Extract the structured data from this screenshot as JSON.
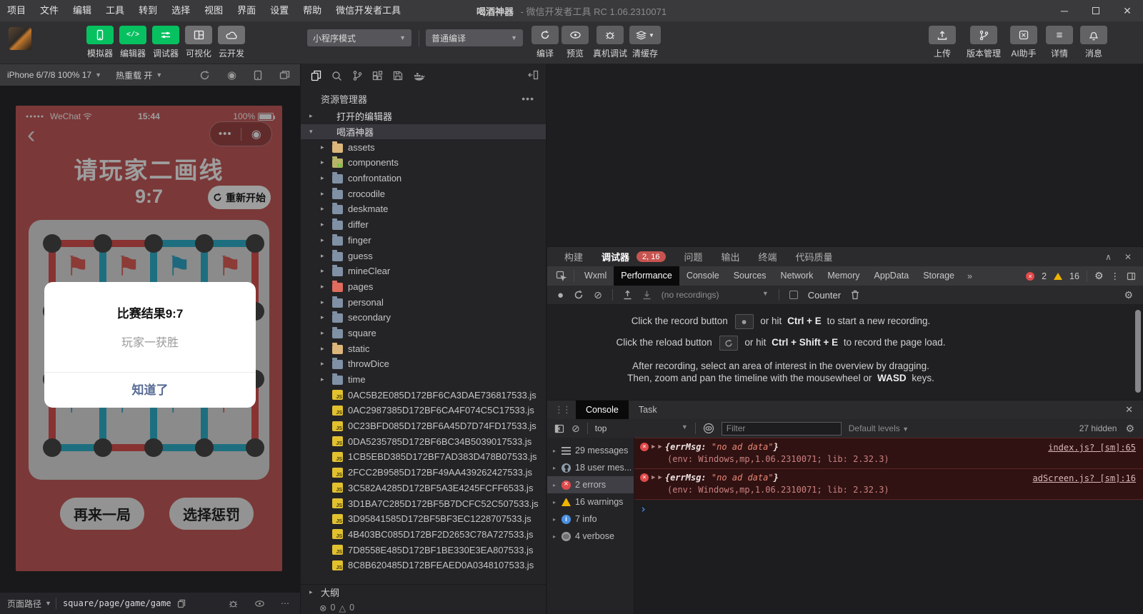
{
  "colors": {
    "green": "#07c160",
    "phone-red": "#c75b5b",
    "board": "#e0e0e0",
    "dot": "#474747",
    "line-red": "#de5252",
    "line-teal": "#2fb3ce",
    "flag-red": "#e25f5a",
    "flag-teal": "#2fa8c8",
    "link-blue": "#576b95"
  },
  "titlebar": {
    "menus": [
      "项目",
      "文件",
      "编辑",
      "工具",
      "转到",
      "选择",
      "视图",
      "界面",
      "设置",
      "帮助",
      "微信开发者工具"
    ],
    "app": "喝酒神器",
    "product": "- 微信开发者工具 RC 1.06.2310071"
  },
  "toolbar": {
    "buttons": [
      {
        "label": "模拟器"
      },
      {
        "label": "编辑器"
      },
      {
        "label": "调试器"
      },
      {
        "label": "可视化"
      },
      {
        "label": "云开发"
      }
    ],
    "mode": "小程序模式",
    "compile_mode": "普通编译",
    "actions": {
      "compile": "编译",
      "preview": "预览",
      "remote": "真机调试",
      "cache": "清缓存"
    },
    "right": [
      {
        "label": "上传"
      },
      {
        "label": "版本管理"
      },
      {
        "label": "AI助手"
      },
      {
        "label": "详情"
      },
      {
        "label": "消息"
      }
    ]
  },
  "simulator": {
    "device": "iPhone 6/7/8 100% 17",
    "hot_reload": "热重载 开",
    "status": {
      "carrier": "WeChat",
      "time": "15:44",
      "battery": "100%"
    },
    "screen": {
      "title": "请玩家二画线",
      "score": "9:7",
      "restart": "重新开始",
      "flags_top": [
        "red",
        "red",
        "teal",
        "red"
      ],
      "flags_bottom": [
        "teal",
        "teal",
        "teal",
        "red"
      ],
      "buttons": [
        {
          "label": "再来一局"
        },
        {
          "label": "选择惩罚"
        }
      ]
    },
    "modal": {
      "title": "比赛结果9:7",
      "subtitle": "玩家一获胜",
      "confirm": "知道了"
    },
    "footer": {
      "label": "页面路径",
      "path": "square/page/game/game"
    }
  },
  "explorer": {
    "header": "资源管理器",
    "tree": [
      {
        "cls": "root",
        "chev": "▸",
        "icon": "",
        "label": "打开的编辑器"
      },
      {
        "cls": "root selected",
        "chev": "▾",
        "icon": "",
        "label": "喝酒神器"
      },
      {
        "cls": "child",
        "chev": "▸",
        "icon": "folder f-yellow",
        "label": "assets"
      },
      {
        "cls": "child",
        "chev": "▸",
        "icon": "folder f-comp",
        "label": "components"
      },
      {
        "cls": "child",
        "chev": "▸",
        "icon": "folder",
        "label": "confrontation"
      },
      {
        "cls": "child",
        "chev": "▸",
        "icon": "folder",
        "label": "crocodile"
      },
      {
        "cls": "child",
        "chev": "▸",
        "icon": "folder",
        "label": "deskmate"
      },
      {
        "cls": "child",
        "chev": "▸",
        "icon": "folder",
        "label": "differ"
      },
      {
        "cls": "child",
        "chev": "▸",
        "icon": "folder",
        "label": "finger"
      },
      {
        "cls": "child",
        "chev": "▸",
        "icon": "folder",
        "label": "guess"
      },
      {
        "cls": "child",
        "chev": "▸",
        "icon": "folder",
        "label": "mineClear"
      },
      {
        "cls": "child",
        "chev": "▸",
        "icon": "folder f-red",
        "label": "pages"
      },
      {
        "cls": "child",
        "chev": "▸",
        "icon": "folder",
        "label": "personal"
      },
      {
        "cls": "child",
        "chev": "▸",
        "icon": "folder",
        "label": "secondary"
      },
      {
        "cls": "child",
        "chev": "▸",
        "icon": "folder",
        "label": "square"
      },
      {
        "cls": "child",
        "chev": "▸",
        "icon": "folder f-yellow",
        "label": "static"
      },
      {
        "cls": "child",
        "chev": "▸",
        "icon": "folder",
        "label": "throwDice"
      },
      {
        "cls": "child",
        "chev": "▸",
        "icon": "folder",
        "label": "time"
      },
      {
        "cls": "child",
        "chev": "",
        "icon": "jsicon",
        "label": "0AC5B2E085D172BF6CA3DAE736817533.js"
      },
      {
        "cls": "child",
        "chev": "",
        "icon": "jsicon",
        "label": "0AC2987385D172BF6CA4F074C5C17533.js"
      },
      {
        "cls": "child",
        "chev": "",
        "icon": "jsicon",
        "label": "0C23BFD085D172BF6A45D7D74FD17533.js"
      },
      {
        "cls": "child",
        "chev": "",
        "icon": "jsicon",
        "label": "0DA5235785D172BF6BC34B5039017533.js"
      },
      {
        "cls": "child",
        "chev": "",
        "icon": "jsicon",
        "label": "1CB5EBD385D172BF7AD383D478B07533.js"
      },
      {
        "cls": "child",
        "chev": "",
        "icon": "jsicon",
        "label": "2FCC2B9585D172BF49AA439262427533.js"
      },
      {
        "cls": "child",
        "chev": "",
        "icon": "jsicon",
        "label": "3C582A4285D172BF5A3E4245FCFF6533.js"
      },
      {
        "cls": "child",
        "chev": "",
        "icon": "jsicon",
        "label": "3D1BA7C285D172BF5B7DCFC52C507533.js"
      },
      {
        "cls": "child",
        "chev": "",
        "icon": "jsicon",
        "label": "3D95841585D172BF5BF3EC1228707533.js"
      },
      {
        "cls": "child",
        "chev": "",
        "icon": "jsicon",
        "label": "4B403BC085D172BF2D2653C78A727533.js"
      },
      {
        "cls": "child",
        "chev": "",
        "icon": "jsicon",
        "label": "7D8558E485D172BF1BE330E3EA807533.js"
      },
      {
        "cls": "child",
        "chev": "",
        "icon": "jsicon",
        "label": "8C8B620485D172BFEAED0A0348107533.js"
      }
    ],
    "outline": "大纲",
    "status": {
      "errors": "0",
      "warnings": "0"
    }
  },
  "debugpanel": {
    "build": "构建",
    "debug": "调试器",
    "badge": "2, 16",
    "issues": "问题",
    "output": "输出",
    "terminal": "终端",
    "quality": "代码质量",
    "tabs": [
      {
        "label": "Wxml",
        "cls": ""
      },
      {
        "label": "Performance",
        "cls": "active"
      },
      {
        "label": "Console",
        "cls": ""
      },
      {
        "label": "Sources",
        "cls": ""
      },
      {
        "label": "Network",
        "cls": ""
      },
      {
        "label": "Memory",
        "cls": ""
      },
      {
        "label": "AppData",
        "cls": ""
      },
      {
        "label": "Storage",
        "cls": ""
      }
    ],
    "overflow": "»",
    "errors": "2",
    "warnings": "16",
    "perf": {
      "recordings": "(no recordings)",
      "counter": "Counter",
      "l1a": "Click the record button",
      "l1b": "or hit",
      "l1key": "Ctrl + E",
      "l1c": "to start a new recording.",
      "l2a": "Click the reload button",
      "l2b": "or hit",
      "l2key": "Ctrl + Shift + E",
      "l2c": "to record the page load.",
      "l3": "After recording, select an area of interest in the overview by dragging.",
      "l4a": "Then, zoom and pan the timeline with the mousewheel or",
      "l4key": "WASD",
      "l4b": "keys."
    }
  },
  "console": {
    "tab1": "Console",
    "tab2": "Task",
    "context": "top",
    "filter_placeholder": "Filter",
    "levels": "Default levels",
    "hidden": "27 hidden",
    "sidebar": [
      {
        "chev": "▸",
        "icon": "ic-list",
        "label": "29 messages",
        "cls": ""
      },
      {
        "chev": "▸",
        "icon": "ic-user",
        "label": "18 user mes...",
        "cls": ""
      },
      {
        "chev": "▸",
        "icon": "ic-error",
        "label": "2 errors",
        "cls": "selected"
      },
      {
        "chev": "▸",
        "icon": "ic-warn",
        "label": "16 warnings",
        "cls": ""
      },
      {
        "chev": "▸",
        "icon": "ic-info",
        "label": "7 info",
        "cls": ""
      },
      {
        "chev": "▸",
        "icon": "ic-bug",
        "label": "4 verbose",
        "cls": ""
      }
    ],
    "messages": [
      {
        "prefix": "{errMsg: ",
        "value": "\"no ad data\"",
        "suffix": "}",
        "source": "index.js? [sm]:65",
        "env": "(env: Windows,mp,1.06.2310071; lib: 2.32.3)"
      },
      {
        "prefix": "{errMsg: ",
        "value": "\"no ad data\"",
        "suffix": "}",
        "source": "adScreen.js? [sm]:16",
        "env": "(env: Windows,mp,1.06.2310071; lib: 2.32.3)"
      }
    ]
  }
}
